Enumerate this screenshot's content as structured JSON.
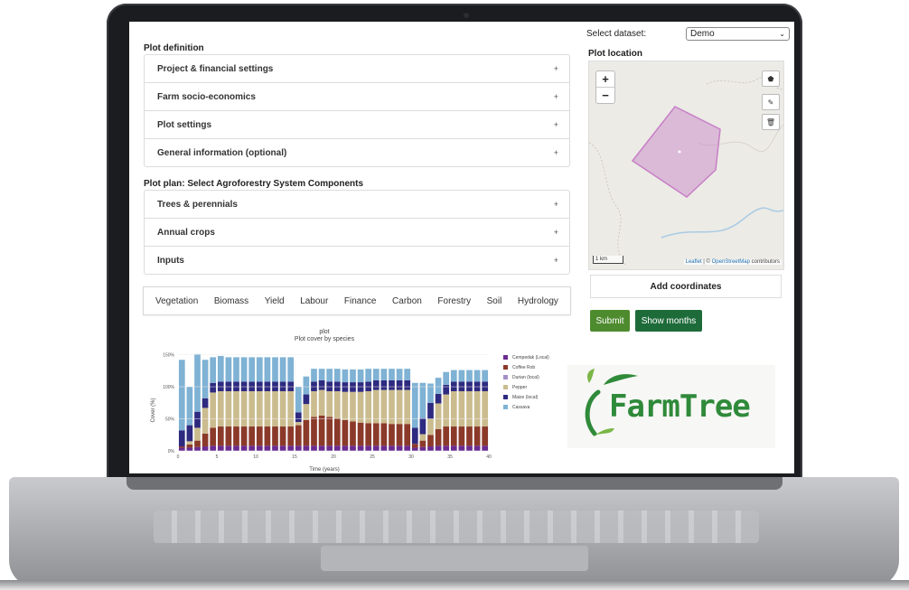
{
  "plot_definition": {
    "title": "Plot definition",
    "items": [
      {
        "label": "Project & financial settings",
        "icon": "+"
      },
      {
        "label": "Farm socio-economics",
        "icon": "+"
      },
      {
        "label": "Plot settings",
        "icon": "+"
      },
      {
        "label": "General information (optional)",
        "icon": "+"
      }
    ]
  },
  "plot_plan": {
    "title": "Plot plan: Select Agroforestry System Components",
    "items": [
      {
        "label": "Trees & perennials",
        "icon": "+"
      },
      {
        "label": "Annual crops",
        "icon": "+"
      },
      {
        "label": "Inputs",
        "icon": "+"
      }
    ]
  },
  "tabs": [
    "Vegetation",
    "Biomass",
    "Yield",
    "Labour",
    "Finance",
    "Carbon",
    "Forestry",
    "Soil",
    "Hydrology"
  ],
  "dataset": {
    "label": "Select dataset:",
    "value": "Demo"
  },
  "map": {
    "title": "Plot location",
    "zoom_in": "+",
    "zoom_out": "−",
    "scale": "1 km",
    "attribution_leaflet": "Leaflet",
    "attribution_sep": " | © ",
    "attribution_osm": "OpenStreetMap",
    "attribution_tail": " contributors",
    "polygon_color": "#c77fc6"
  },
  "buttons": {
    "add_coordinates": "Add coordinates",
    "submit": "Submit",
    "show_months": "Show months",
    "submit_color": "#4e8b2f",
    "show_months_color": "#1e6b3a"
  },
  "logo": {
    "text": "FarmTree",
    "color": "#2f8a3a"
  },
  "chart_data": {
    "type": "bar",
    "stacked": true,
    "title": "plot",
    "subtitle": "Plot cover by species",
    "xlabel": "Time (years)",
    "ylabel": "Cover (%)",
    "xlim": [
      0,
      40
    ],
    "ylim": [
      0,
      155
    ],
    "x_ticks": [
      0,
      5,
      10,
      15,
      20,
      25,
      30,
      35,
      40
    ],
    "y_ticks": [
      0,
      50,
      100,
      150
    ],
    "y_tick_labels": [
      "0%",
      "50%",
      "100%",
      "150%"
    ],
    "x": [
      1,
      2,
      3,
      4,
      5,
      6,
      7,
      8,
      9,
      10,
      11,
      12,
      13,
      14,
      15,
      16,
      17,
      18,
      19,
      20,
      21,
      22,
      23,
      24,
      25,
      26,
      27,
      28,
      29,
      30,
      31,
      32,
      33,
      34,
      35,
      36,
      37,
      38,
      39,
      40
    ],
    "series": [
      {
        "name": "Cempedak (Local)",
        "color": "#6a2c91",
        "values": [
          5,
          5,
          6,
          7,
          8,
          8,
          8,
          8,
          8,
          8,
          8,
          8,
          8,
          8,
          8,
          8,
          8,
          8,
          8,
          8,
          8,
          8,
          8,
          8,
          8,
          8,
          8,
          8,
          8,
          8,
          5,
          6,
          7,
          8,
          8,
          8,
          8,
          8,
          8,
          8
        ]
      },
      {
        "name": "Coffee Rob",
        "color": "#8b3a2a",
        "values": [
          2,
          5,
          10,
          20,
          28,
          30,
          30,
          30,
          30,
          30,
          30,
          30,
          30,
          30,
          30,
          32,
          40,
          45,
          47,
          45,
          43,
          40,
          38,
          36,
          35,
          35,
          35,
          34,
          34,
          34,
          6,
          10,
          18,
          26,
          30,
          30,
          30,
          30,
          30,
          30
        ]
      },
      {
        "name": "Durian (local)",
        "color": "#a58fc7",
        "values": [
          0,
          0,
          0,
          0,
          0,
          0,
          0,
          0,
          0,
          0,
          0,
          0,
          0,
          0,
          0,
          0,
          0,
          0,
          0,
          0,
          0,
          0,
          0,
          0,
          0,
          0,
          0,
          0,
          0,
          0,
          0,
          0,
          0,
          0,
          0,
          0,
          0,
          0,
          0,
          0
        ]
      },
      {
        "name": "Pepper",
        "color": "#cbbc8f",
        "values": [
          0,
          5,
          20,
          40,
          55,
          55,
          55,
          55,
          55,
          55,
          55,
          55,
          55,
          55,
          55,
          5,
          25,
          40,
          40,
          40,
          42,
          44,
          46,
          48,
          50,
          52,
          52,
          53,
          53,
          53,
          0,
          10,
          25,
          40,
          50,
          55,
          55,
          55,
          55,
          55
        ]
      },
      {
        "name": "Maize (local)",
        "color": "#2e2a80",
        "values": [
          25,
          25,
          25,
          15,
          15,
          15,
          15,
          15,
          15,
          15,
          15,
          15,
          15,
          15,
          15,
          15,
          15,
          15,
          15,
          15,
          15,
          15,
          15,
          15,
          15,
          15,
          15,
          15,
          15,
          15,
          25,
          25,
          25,
          15,
          15,
          15,
          15,
          15,
          15,
          15
        ]
      },
      {
        "name": "Cassava",
        "color": "#7fb2d4",
        "values": [
          110,
          60,
          90,
          60,
          40,
          40,
          38,
          38,
          38,
          38,
          38,
          38,
          38,
          38,
          38,
          40,
          28,
          20,
          18,
          20,
          20,
          20,
          20,
          20,
          20,
          18,
          18,
          18,
          18,
          18,
          70,
          55,
          30,
          25,
          20,
          18,
          18,
          18,
          18,
          18
        ]
      }
    ]
  }
}
